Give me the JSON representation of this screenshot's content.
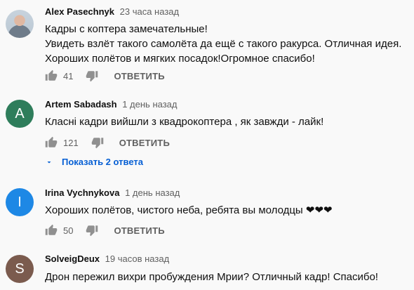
{
  "comments": [
    {
      "author": "Alex Pasechnyk",
      "time": "23 часа назад",
      "lines": [
        "Кадры с коптера замечательные!",
        "Увидеть взлёт такого самолёта да ещё с такого ракурса. Отличная идея.",
        "Хороших полётов и мягких посадок!Огромное спасибо!"
      ],
      "likes": "41",
      "reply_label": "ОТВЕТИТЬ"
    },
    {
      "author": "Artem Sabadash",
      "time": "1 день назад",
      "avatar_letter": "A",
      "avatar_color": "#2e7d5b",
      "lines": [
        "Класні кадри вийшли з квадрокоптера , як завжди - лайк!"
      ],
      "likes": "121",
      "reply_label": "ОТВЕТИТЬ",
      "replies_label": "Показать 2 ответа"
    },
    {
      "author": "Irina Vychnykova",
      "time": "1 день назад",
      "avatar_letter": "I",
      "avatar_color": "#1e88e5",
      "lines": [
        "Хороших полётов, чистого неба, ребята вы молодцы ❤❤❤"
      ],
      "likes": "50",
      "reply_label": "ОТВЕТИТЬ"
    },
    {
      "author": "SolveigDeux",
      "time": "19 часов назад",
      "avatar_letter": "S",
      "avatar_color": "#7b5b4e",
      "lines": [
        "Дрон пережил вихри пробуждения Мрии? Отличный кадр! Спасибо!"
      ]
    }
  ],
  "colors": {
    "link": "#065fd4",
    "secondary": "#606060"
  },
  "icons": {
    "like": "thumb-up-icon",
    "dislike": "thumb-down-icon",
    "expand": "chevron-down-icon"
  }
}
